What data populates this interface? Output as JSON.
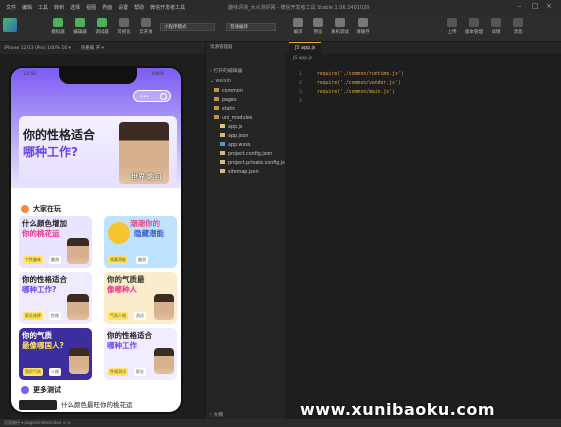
{
  "menu": [
    "文件",
    "编辑",
    "工具",
    "转到",
    "选择",
    "视图",
    "界面",
    "设置",
    "帮助",
    "微信开发者工具"
  ],
  "window_title": "趣味评测_大众测评网 - 微信开发者工具 Stable 1.06.2401020",
  "toolbar": {
    "sim": "模拟器",
    "editor": "编辑器",
    "debugger": "调试器",
    "visual": "可视化",
    "cloud": "云开发",
    "mode": "小程序模式",
    "compile_mode": "普通编译",
    "compile": "编译",
    "preview": "预览",
    "real_debug": "真机调试",
    "clear_cache": "清缓存",
    "upload": "上传",
    "version": "版本管理",
    "detail": "详情",
    "message": "消息"
  },
  "simbar": {
    "device": "iPhone 12/13 (Pro) 100% 16 ▾",
    "hot": "热重载 开 ▾"
  },
  "phone": {
    "time": "13:50",
    "battery": "100%",
    "banner_title_1": "你的性格适合",
    "banner_title_2": "哪种工作?",
    "banner_sub": "世界·趣问",
    "popular": "大家在玩",
    "more": "更多测试",
    "bottom_card": "什么颜色最旺你的桃花运"
  },
  "cards": [
    {
      "t1": "什么颜色增加",
      "t2": "你的桃花运",
      "tag1": "个性趣味",
      "tag2": "趣测",
      "count": "1453"
    },
    {
      "t1": "潮潮你的",
      "t2": "隐藏潜能",
      "tag1": "隐藏潜能",
      "tag2": "趣测",
      "count": "1453"
    },
    {
      "t1": "你的性格适合",
      "t2": "哪种工作?",
      "tag1": "职业选择",
      "tag2": "性格",
      "count": "1453"
    },
    {
      "t1": "你的气质最",
      "t2": "像哪种人",
      "tag1": "气质人格",
      "tag2": "测试",
      "count": "1453"
    },
    {
      "t1": "你的气质",
      "t2": "最像哪国人?",
      "tag1": "国民气质",
      "tag2": "人格",
      "count": "1453"
    },
    {
      "t1": "你的性格适合",
      "t2": "哪种工作",
      "tag1": "性格测试",
      "tag2": "职业",
      "count": "1453"
    }
  ],
  "explorer": {
    "header": "资源管理器",
    "open_editors": "打开的编辑器",
    "project": "weixin",
    "outline": "大纲",
    "files": [
      {
        "name": "common",
        "type": "folder"
      },
      {
        "name": "pages",
        "type": "folder"
      },
      {
        "name": "static",
        "type": "folder"
      },
      {
        "name": "uni_modules",
        "type": "folder"
      },
      {
        "name": "app.js",
        "type": "js"
      },
      {
        "name": "app.json",
        "type": "json"
      },
      {
        "name": "app.wxss",
        "type": "wxss"
      },
      {
        "name": "project.config.json",
        "type": "json"
      },
      {
        "name": "project.private.config.js...",
        "type": "json"
      },
      {
        "name": "sitemap.json",
        "type": "json"
      }
    ]
  },
  "editor": {
    "tab": "app.js",
    "crumb": "JS app.js",
    "lines": [
      "1",
      "2",
      "3",
      "4"
    ],
    "code": [
      "require('./common/runtime.js')",
      "require('./common/vendor.js')",
      "require('./common/main.js')",
      ""
    ]
  },
  "statusbar": "页面路径 ▾   pages/index/index   ⊙   ◎",
  "watermark": "www.xunibaoku.com"
}
